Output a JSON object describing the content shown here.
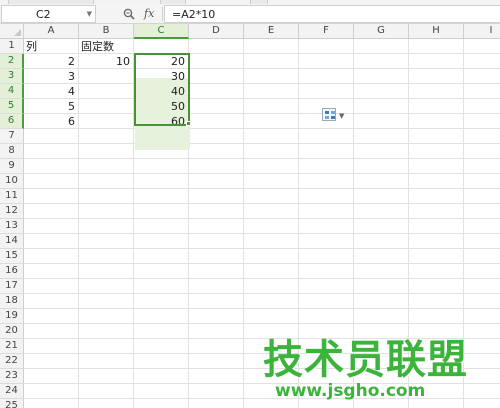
{
  "formula_bar": {
    "name_box": "C2",
    "fx_label": "fx",
    "formula": "=A2*10"
  },
  "columns": [
    "A",
    "B",
    "C",
    "D",
    "E",
    "F",
    "G",
    "H",
    "I"
  ],
  "rows": [
    "1",
    "2",
    "3",
    "4",
    "5",
    "6",
    "7",
    "8",
    "9",
    "10",
    "11",
    "12",
    "13",
    "14",
    "15",
    "16",
    "17",
    "18",
    "19",
    "20",
    "21",
    "22",
    "23",
    "24",
    "25"
  ],
  "selected_column": "C",
  "selected_rows": [
    "2",
    "3",
    "4",
    "5",
    "6"
  ],
  "cells": {
    "A1": "列",
    "B1": "固定数",
    "A2": "2",
    "B2": "10",
    "C2": "20",
    "A3": "3",
    "C3": "30",
    "A4": "4",
    "C4": "40",
    "A5": "5",
    "C5": "50",
    "A6": "6",
    "C6": "60"
  },
  "watermark": {
    "title": "技术员联盟",
    "url": "www.jsgho.com"
  },
  "icons": {
    "zoom": "zoom-icon",
    "paste_options": "paste-options-icon"
  },
  "colors": {
    "selection_border": "#4a8f3a",
    "selection_fill": "#e6f2db",
    "watermark": "#3cb43c"
  }
}
